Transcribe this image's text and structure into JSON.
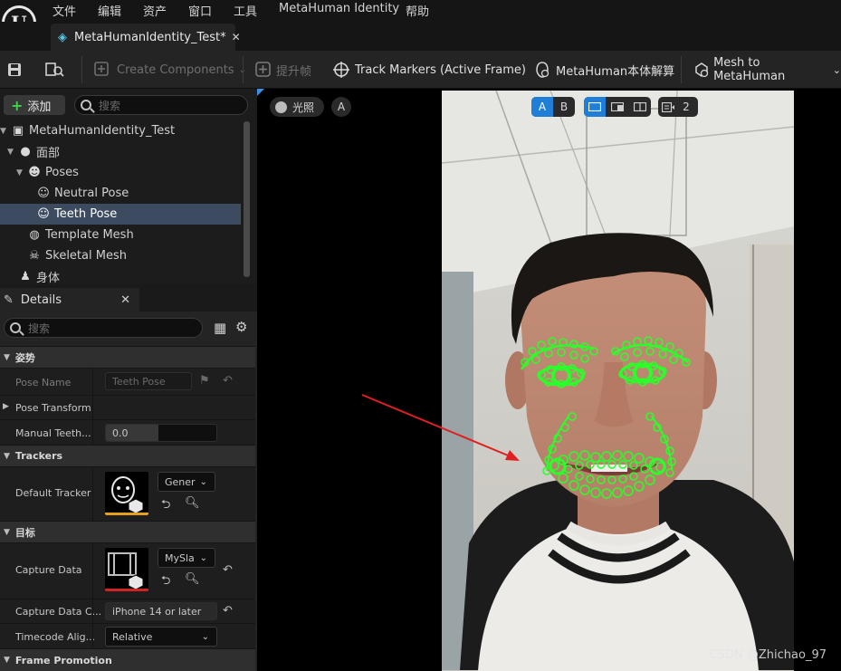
{
  "menu": [
    "文件",
    "编辑",
    "资产",
    "窗口",
    "工具",
    "MetaHuman Identity",
    "帮助"
  ],
  "tab": {
    "title": "MetaHumanIdentity_Test*"
  },
  "toolbar": {
    "create_components": "Create Components",
    "promote_frame": "提升帧",
    "track_markers": "Track Markers (Active Frame)",
    "identity_solve": "MetaHuman本体解算",
    "mesh_to_metahuman": "Mesh to MetaHuman"
  },
  "outliner": {
    "add_label": "添加",
    "search_placeholder": "搜索",
    "items": [
      {
        "label": "MetaHumanIdentity_Test",
        "icon": "identity-icon"
      },
      {
        "label": "面部",
        "icon": "face-icon"
      },
      {
        "label": "Poses",
        "icon": "poses-icon"
      },
      {
        "label": "Neutral Pose",
        "icon": "mask-icon"
      },
      {
        "label": "Teeth Pose",
        "icon": "mask-icon"
      },
      {
        "label": "Template Mesh",
        "icon": "mesh-icon"
      },
      {
        "label": "Skeletal Mesh",
        "icon": "skull-icon"
      },
      {
        "label": "身体",
        "icon": "body-icon"
      }
    ]
  },
  "details": {
    "tab_label": "Details",
    "search_placeholder": "搜索",
    "sections": {
      "pose": "姿势",
      "trackers": "Trackers",
      "target": "目标",
      "frame_promotion": "Frame Promotion"
    },
    "pose_name_label": "Pose Name",
    "pose_name_value": "Teeth Pose",
    "pose_transform_label": "Pose Transform",
    "manual_teeth_label": "Manual Teeth...",
    "manual_teeth_value": "0.0",
    "default_tracker_label": "Default Tracker",
    "default_tracker_value": "Gener",
    "capture_data_label": "Capture Data",
    "capture_data_value": "MySla",
    "capture_data_camera_label": "Capture Data C...",
    "capture_data_camera_value": "iPhone 14 or later",
    "timecode_label": "Timecode Alig...",
    "timecode_value": "Relative"
  },
  "viewport": {
    "lighting_label": "光照",
    "a_label": "A",
    "ab_a": "A",
    "ab_b": "B",
    "camera_count": "2",
    "watermark": "CSDN @Zhichao_97"
  },
  "colors": {
    "accent": "#1f7fd8",
    "tracker": "#2aff2a",
    "selected_row": "#3d4b61"
  }
}
